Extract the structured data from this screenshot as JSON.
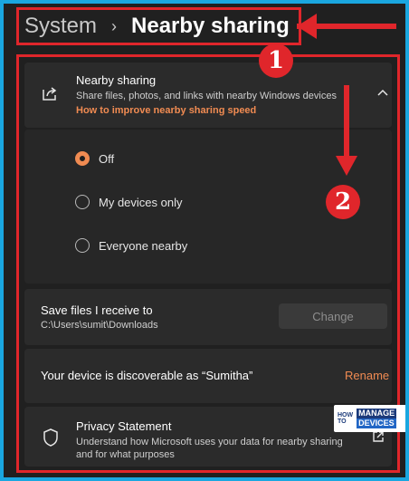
{
  "breadcrumb": {
    "parent": "System",
    "separator": "›",
    "current": "Nearby sharing"
  },
  "annotations": {
    "badge_1": "1",
    "badge_2": "2"
  },
  "nearby_sharing": {
    "title": "Nearby sharing",
    "description": "Share files, photos, and links with nearby Windows devices",
    "link": "How to improve nearby sharing speed",
    "icon": "share-icon",
    "expanded": true
  },
  "options": [
    {
      "label": "Off",
      "selected": true
    },
    {
      "label": "My devices only",
      "selected": false
    },
    {
      "label": "Everyone nearby",
      "selected": false
    }
  ],
  "save_files": {
    "label": "Save files I receive to",
    "path": "C:\\Users\\sumit\\Downloads",
    "button": "Change"
  },
  "discoverable": {
    "label": "Your device is discoverable as “Sumitha”",
    "action": "Rename"
  },
  "privacy": {
    "title": "Privacy Statement",
    "description": "Understand how Microsoft uses your data for nearby sharing and for what purposes",
    "icon": "shield-icon"
  },
  "watermark": {
    "how": "HOW",
    "to": "TO",
    "manage": "MANAGE",
    "devices": "DEVICES"
  },
  "colors": {
    "accent": "#f08b52",
    "annotation": "#e0262b",
    "background": "#202020",
    "card": "#2b2b2b"
  }
}
